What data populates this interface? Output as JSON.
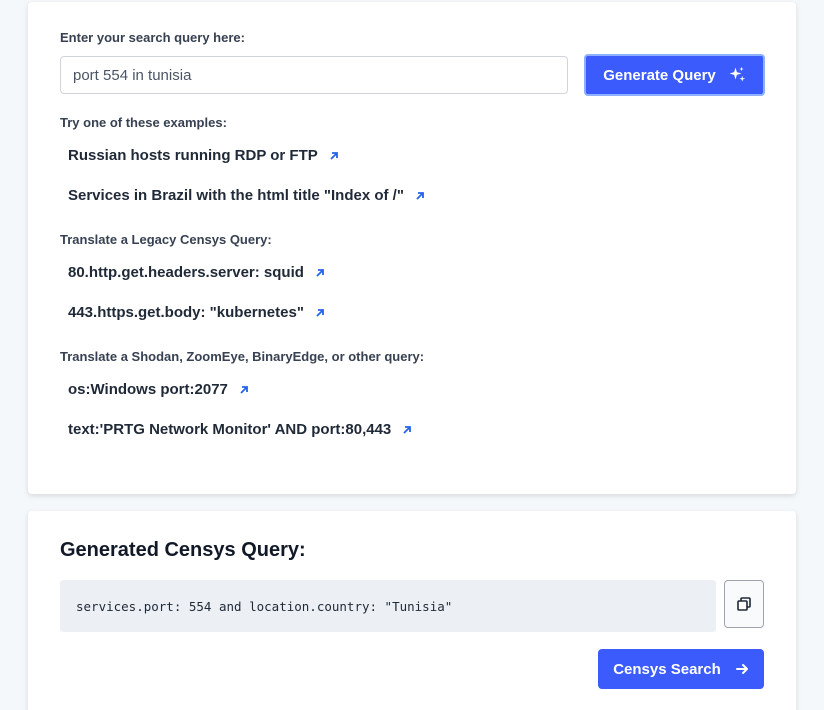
{
  "search": {
    "label": "Enter your search query here:",
    "value": "port 554 in tunisia",
    "button_label": "Generate Query"
  },
  "sections": [
    {
      "title": "Try one of these examples:",
      "items": [
        "Russian hosts running RDP or FTP",
        "Services in Brazil with the html title \"Index of /\""
      ]
    },
    {
      "title": "Translate a Legacy Censys Query:",
      "items": [
        "80.http.get.headers.server: squid",
        "443.https.get.body: \"kubernetes\""
      ]
    },
    {
      "title": "Translate a Shodan, ZoomEye, BinaryEdge, or other query:",
      "items": [
        "os:Windows port:2077",
        "text:'PRTG Network Monitor' AND port:80,443"
      ]
    }
  ],
  "result": {
    "title": "Generated Censys Query:",
    "query": "services.port: 554 and location.country: \"Tunisia\"",
    "button_label": "Censys Search"
  },
  "colors": {
    "accent": "#3b5bfd",
    "link_icon": "#2563eb"
  }
}
